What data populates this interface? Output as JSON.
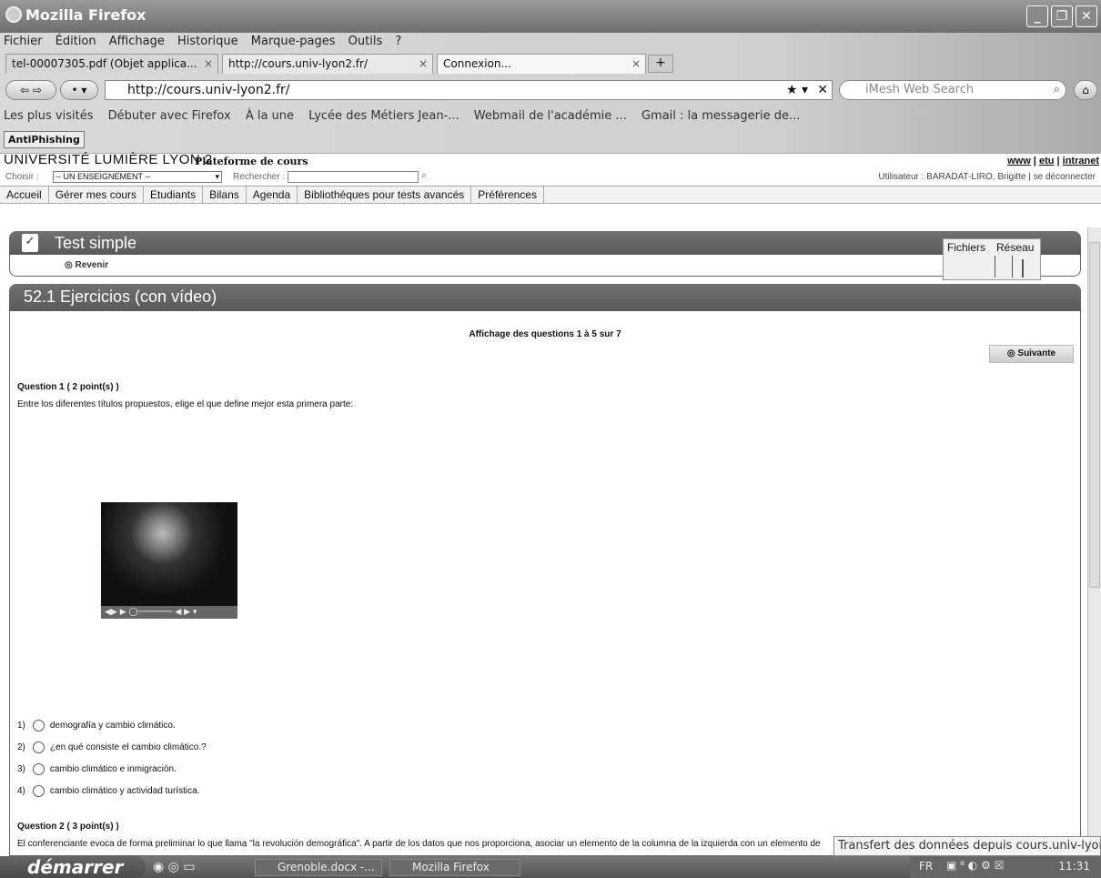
{
  "window": {
    "title": "Mozilla Firefox"
  },
  "menu": [
    "Fichier",
    "Édition",
    "Affichage",
    "Historique",
    "Marque-pages",
    "Outils",
    "?"
  ],
  "tabs": [
    {
      "label": "tel-00007305.pdf (Objet applica..."
    },
    {
      "label": "http://cours.univ-lyon2.fr/"
    },
    {
      "label": "Connexion..."
    }
  ],
  "url": "http://cours.univ-lyon2.fr/",
  "search_placeholder": "iMesh Web Search",
  "bookmarks": [
    "Les plus visités",
    "Débuter avec Firefox",
    "À la une",
    "Lycée des Métiers Jean-...",
    "Webmail de l'académie ...",
    "Gmail : la messagerie de..."
  ],
  "antiphishing": "AntiPhishing",
  "site": {
    "university": "UNIVERSITÉ LUMIÈRE LYON 2",
    "platform": "Plateforme de cours",
    "links": [
      "www",
      "etu",
      "intranet"
    ],
    "choose_label": "Choisir :",
    "choose_value": "-- UN ENSEIGNEMENT --",
    "search_label": "Rechercher :",
    "user": "Utilisateur : BARADAT-LIRO, Brigitte | se déconnecter",
    "nav": [
      "Accueil",
      "Gérer mes cours",
      "Etudiants",
      "Bilans",
      "Agenda",
      "Bibliothèques pour tests avancés",
      "Préférences"
    ]
  },
  "panel1": {
    "title": "Test simple",
    "back": "Revenir",
    "net_files": "Fichiers",
    "net_network": "Réseau"
  },
  "panel2": {
    "title": "52.1 Ejercicios (con vídeo)",
    "display_info": "Affichage des questions 1 à 5 sur 7",
    "next": "Suivante",
    "q1_title": "Question 1 ( 2 point(s) )",
    "q1_text": "Entre los diferentes títulos propuestos, elige el que define mejor esta primera parte:",
    "options": [
      {
        "num": "1)",
        "text": "demografía y cambio climático."
      },
      {
        "num": "2)",
        "text": "¿en qué consiste el cambio climático.?"
      },
      {
        "num": "3)",
        "text": "cambio climático e inmigración."
      },
      {
        "num": "4)",
        "text": "cambio climático y actividad turística."
      }
    ],
    "q2_title": "Question 2 ( 3 point(s) )",
    "q2_text": "El conferenciante evoca de forma preliminar lo que llama \"la revolución demográfica\". A partir de los datos que nos proporciona, asociar un elemento de la columna de la izquierda con un elemento de"
  },
  "status": "Transfert des données depuis cours.univ-lyon2.fr...",
  "taskbar": {
    "start": "démarrer",
    "items": [
      "Grenoble.docx -...",
      "Mozilla Firefox"
    ],
    "lang": "FR",
    "time": "11:31"
  }
}
